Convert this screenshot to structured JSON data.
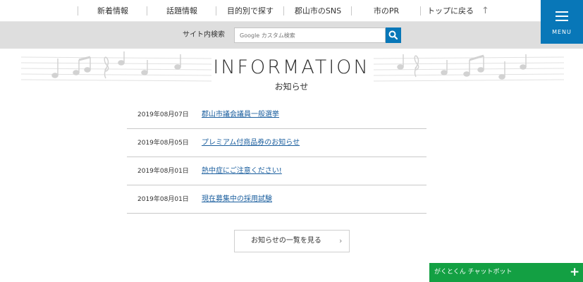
{
  "nav": {
    "items": [
      "新着情報",
      "話題情報",
      "目的別で探す",
      "郡山市のSNS",
      "市のPR",
      "トップに戻る"
    ],
    "up_icon": "arrow-up-icon"
  },
  "menu": {
    "label": "MENU",
    "icon": "hamburger-icon"
  },
  "search": {
    "label": "サイト内検索",
    "placeholder": "Google カスタム検索",
    "button_icon": "search-icon",
    "accent": "#0877b8"
  },
  "info": {
    "title": "INFORMATION",
    "subtitle": "お知らせ",
    "items": [
      {
        "date": "2019年08月07日",
        "title": "郡山市議会議員一般選挙"
      },
      {
        "date": "2019年08月05日",
        "title": "プレミアム付商品券のお知らせ"
      },
      {
        "date": "2019年08月01日",
        "title": "熱中症にご注意ください!"
      },
      {
        "date": "2019年08月01日",
        "title": "現在募集中の採用試験"
      }
    ],
    "more_label": "お知らせの一覧を見る"
  },
  "chatbot": {
    "label": "がくとくん チャットボット",
    "icon": "plus-icon",
    "color": "#13a043"
  },
  "decor": {
    "icon": "music-notes-icon"
  }
}
